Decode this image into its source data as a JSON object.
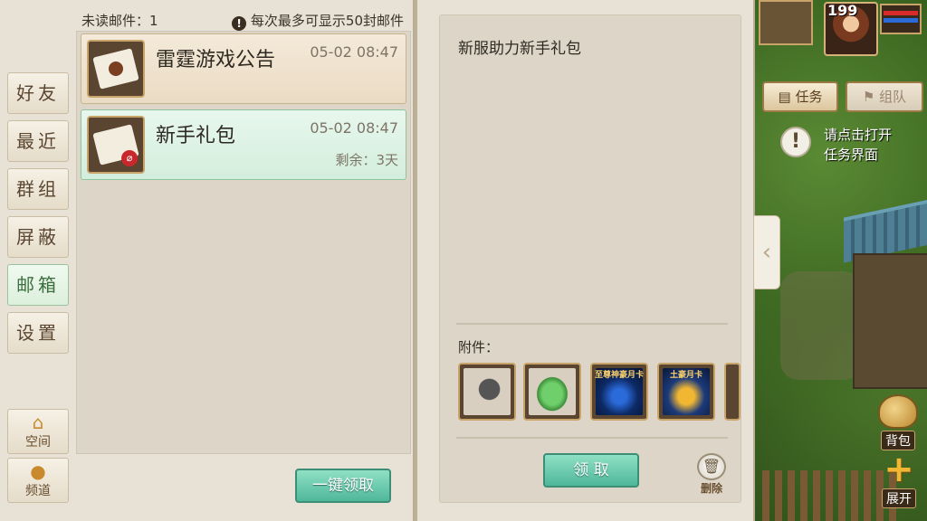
{
  "header": {
    "unread_label": "未读邮件：1",
    "notice_icon": "!",
    "notice_text": "每次最多可显示50封邮件"
  },
  "tabs": [
    {
      "label": "好友"
    },
    {
      "label": "最近"
    },
    {
      "label": "群组"
    },
    {
      "label": "屏蔽"
    },
    {
      "label": "邮箱",
      "active": true
    },
    {
      "label": "设置"
    }
  ],
  "bottom_tabs": {
    "space": {
      "icon": "home-icon",
      "label": "空间"
    },
    "channel": {
      "icon": "chat-icon",
      "label": "频道"
    }
  },
  "mails": [
    {
      "title": "雷霆游戏公告",
      "time": "05-02 08:47",
      "remain": ""
    },
    {
      "title": "新手礼包",
      "time": "05-02 08:47",
      "remain": "剩余：3天"
    }
  ],
  "claim_all_label": "一键领取",
  "detail": {
    "title": "新服助力新手礼包",
    "attachments_label": "附件：",
    "attachments": [
      {
        "icon": "donkey-mount-icon",
        "caption": ""
      },
      {
        "icon": "lotus-leaf-icon",
        "caption": ""
      },
      {
        "icon": "supreme-monthly-card-icon",
        "caption": "至尊神豪月卡"
      },
      {
        "icon": "tycoon-monthly-card-icon",
        "caption": "土豪月卡"
      }
    ],
    "claim_label": "领 取",
    "delete_label": "删除"
  },
  "hud": {
    "level": "199",
    "quest_label": "任务",
    "team_label": "组队",
    "tip_icon": "!",
    "tip_line1": "请点击打开",
    "tip_line2": "任务界面",
    "bag_label": "背包",
    "expand_label": "展开",
    "collapse_glyph": "‹"
  }
}
